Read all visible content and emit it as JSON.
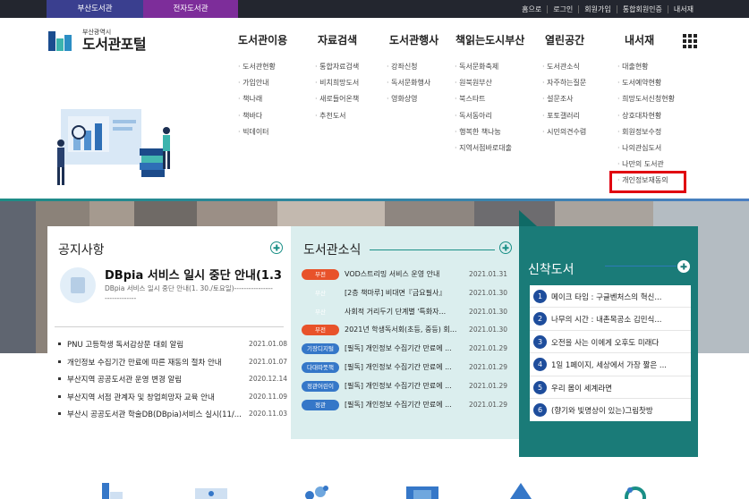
{
  "site_tabs": [
    "부산도서관",
    "전자도서관"
  ],
  "util_links": [
    "홈으로",
    "로그인",
    "회원가입",
    "통합회원인증",
    "내서재"
  ],
  "logo": {
    "sub": "부산광역시",
    "main": "도서관포털"
  },
  "gnb": [
    {
      "label": "도서관이용",
      "items": [
        "도서관현황",
        "가입안내",
        "책나래",
        "책바다",
        "빅데이터"
      ]
    },
    {
      "label": "자료검색",
      "items": [
        "통합자료검색",
        "비치희망도서",
        "새로들어온책",
        "추천도서"
      ]
    },
    {
      "label": "도서관행사",
      "items": [
        "강좌신청",
        "독서문화행사",
        "영화상영"
      ]
    },
    {
      "label": "책읽는도시부산",
      "items": [
        "독서문화축제",
        "원북원부산",
        "북스타트",
        "독서동아리",
        "행복한 책나눔",
        "지역서점바로대출"
      ]
    },
    {
      "label": "열린공간",
      "items": [
        "도서관소식",
        "자주하는질문",
        "설문조사",
        "포토갤러리",
        "시민의견수렴"
      ]
    },
    {
      "label": "내서재",
      "items": [
        "대출현황",
        "도서예약현황",
        "희망도서신청현황",
        "상호대차현황",
        "회원정보수정",
        "나의관심도서",
        "나만의 도서관",
        "개인정보재동의"
      ]
    }
  ],
  "notice": {
    "title": "공지사항",
    "feature_title": "DBpia 서비스 일시 중단 안내(1.3",
    "feature_sub": "DBpia 서비스 일시 중단 안내(1. 30./토요일)-----------------------------",
    "rows": [
      {
        "title": "PNU 고등학생 독서감상문 대회 알림",
        "date": "2021.01.08"
      },
      {
        "title": "개인정보 수집기간 만료에 따른 재동의 절차 안내",
        "date": "2021.01.07"
      },
      {
        "title": "부산지역 공공도서관 운영 변경 알림",
        "date": "2020.12.14"
      },
      {
        "title": "부산지역 서점 관계자 및 창업희망자 교육 안내",
        "date": "2020.11.09"
      },
      {
        "title": "부산시 공공도서관 학술DB(DBpia)서비스 실시(11/...",
        "date": "2020.11.03"
      }
    ]
  },
  "news": {
    "title": "도서관소식",
    "rows": [
      {
        "badge": "부전",
        "color": "#e8522a",
        "title": "VOD스트리밍 서비스 운영 안내",
        "date": "2021.01.31"
      },
      {
        "badge": "부산",
        "color": "#dbeeee",
        "title": "[2층 책마루] 비대면『금요필사』",
        "date": "2021.01.30"
      },
      {
        "badge": "부산",
        "color": "#dbeeee",
        "title": "사회적 거리두기 단계별 '특화자...",
        "date": "2021.01.30"
      },
      {
        "badge": "부전",
        "color": "#e8522a",
        "title": "2021년 학생독서회(초등, 중등) 회...",
        "date": "2021.01.30"
      },
      {
        "badge": "기장디지털",
        "color": "#3577c8",
        "title": "[필독] 개인정보 수집기간 만료에 ...",
        "date": "2021.01.29"
      },
      {
        "badge": "다대따뜻책",
        "color": "#3577c8",
        "title": "[필독] 개인정보 수집기간 만료에 ...",
        "date": "2021.01.29"
      },
      {
        "badge": "정관어린이",
        "color": "#3577c8",
        "title": "[필독] 개인정보 수집기간 만료에 ...",
        "date": "2021.01.29"
      },
      {
        "badge": "정관",
        "color": "#3577c8",
        "title": "[필독] 개인정보 수집기간 만료에 ...",
        "date": "2021.01.29"
      }
    ]
  },
  "new_books": {
    "title": "신착도서",
    "rows": [
      {
        "n": "1",
        "title": "메이크 타임 : 구글벤처스의 혁신..."
      },
      {
        "n": "2",
        "title": "나무의 시간 : 내촌목공소 김민식..."
      },
      {
        "n": "3",
        "title": "오전을 사는 이에게 오후도 미래다"
      },
      {
        "n": "4",
        "title": "1일 1페이지, 세상에서 가장 짧은 ..."
      },
      {
        "n": "5",
        "title": "우리 몸이 세계라면"
      },
      {
        "n": "6",
        "title": "(향기와 빛명상이 있는)그림찻방"
      }
    ]
  },
  "colors": {
    "topbar": "#23262f",
    "accent_teal": "#1a7b78",
    "highlight": "#e00010"
  },
  "icons": [
    "grid-menu-icon",
    "plus-circle-icon",
    "document-icon"
  ]
}
